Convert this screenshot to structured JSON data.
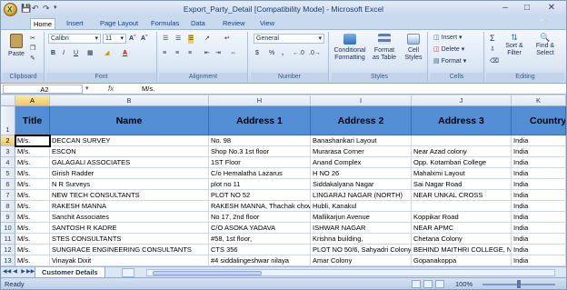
{
  "window": {
    "title": "Export_Party_Detail  [Compatibility Mode] - Microsoft Excel",
    "minimize": "–",
    "maximize": "□",
    "close": "✕"
  },
  "ribbon_tabs": [
    "Home",
    "Insert",
    "Page Layout",
    "Formulas",
    "Data",
    "Review",
    "View"
  ],
  "ribbon": {
    "clipboard": {
      "label": "Clipboard",
      "paste": "Paste"
    },
    "font": {
      "label": "Font",
      "font_name": "Calibri",
      "font_size": "11"
    },
    "alignment": {
      "label": "Alignment"
    },
    "number": {
      "label": "Number",
      "format": "General",
      "currency": "$",
      "percent": "%",
      "comma": ","
    },
    "styles": {
      "label": "Styles",
      "conditional": "Conditional",
      "conditional2": "Formatting",
      "format_table": "Format",
      "format_table2": "as Table",
      "cell_styles": "Cell",
      "cell_styles2": "Styles"
    },
    "cells": {
      "label": "Cells",
      "insert": "Insert",
      "delete": "Delete",
      "format": "Format"
    },
    "editing": {
      "label": "Editing",
      "sort": "Sort &",
      "sort2": "Filter",
      "find": "Find &",
      "find2": "Select",
      "sum": "Σ"
    }
  },
  "formula_bar": {
    "name_box": "A2",
    "fx": "fx",
    "content": "M/s."
  },
  "columns": [
    "A",
    "B",
    "H",
    "I",
    "J",
    "K"
  ],
  "header_row": [
    "Title",
    "Name",
    "Address 1",
    "Address 2",
    "Address 3",
    "Country"
  ],
  "rows": [
    {
      "num": "2",
      "cells": [
        "M/s.",
        "DECCAN SURVEY",
        "No. 98",
        "Banashankari Layout",
        "",
        "India"
      ]
    },
    {
      "num": "3",
      "cells": [
        "M/s.",
        "ESCON",
        "Shop No.3 1st floor",
        "Murarasa Corner",
        "Near Azad colony",
        "India"
      ]
    },
    {
      "num": "4",
      "cells": [
        "M/s.",
        "GALAGALI ASSOCIATES",
        "1ST Floor",
        "Anand Complex",
        "Opp. Kotambari College",
        "India"
      ]
    },
    {
      "num": "5",
      "cells": [
        "M/s.",
        "Girish Radder",
        "C/o Hemalatha Lazarus",
        "H NO 26",
        "Mahalxmi Layout",
        "India"
      ]
    },
    {
      "num": "6",
      "cells": [
        "M/s.",
        "N R Surveys",
        "plot no 11",
        "Siddakalyana Nagar",
        "Sai Nagar Road",
        "India"
      ]
    },
    {
      "num": "7",
      "cells": [
        "M/s.",
        "NEW TECH CONSULTANTS",
        "PLOT NO 52",
        "LINGARAJ NAGAR (NORTH)",
        "NEAR UNKAL CROSS",
        "India"
      ]
    },
    {
      "num": "8",
      "cells": [
        "M/s.",
        "RAKESH MANNA",
        "RAKESH MANNA, Thachak chowk, Aarvind Pat",
        "Hubli, Kanakul",
        "",
        "India"
      ]
    },
    {
      "num": "9",
      "cells": [
        "M/s.",
        "Sanchit Associates",
        "No 17, 2nd floor",
        "Mallikarjun Avenue",
        "Koppikar Road",
        "India"
      ]
    },
    {
      "num": "10",
      "cells": [
        "M/s.",
        "SANTOSH R KADRE",
        "C/O ASOKA YADAVA",
        "ISHWAR NAGAR",
        "NEAR APMC",
        "India"
      ]
    },
    {
      "num": "11",
      "cells": [
        "M/s.",
        "STES CONSULTANTS",
        "#58, 1st floor,",
        "Krishna building,",
        "Chetana Colony",
        "India"
      ]
    },
    {
      "num": "12",
      "cells": [
        "M/s.",
        "SUNGRACE ENGINEERING CONSULTANTS",
        "CTS 356",
        "PLOT NO 50/6, Sahyadri Colony",
        "BEHIND MAITHRI COLLEGE, N",
        "India"
      ]
    },
    {
      "num": "13",
      "cells": [
        "M/s.",
        "Vinayak Dixit",
        "#4 siddalingeshwar nilaya",
        "Amar Colony",
        "Gopanakoppa",
        "India"
      ]
    }
  ],
  "sheet_tab": "Customer Details",
  "status": {
    "ready": "Ready",
    "zoom": "100%"
  }
}
